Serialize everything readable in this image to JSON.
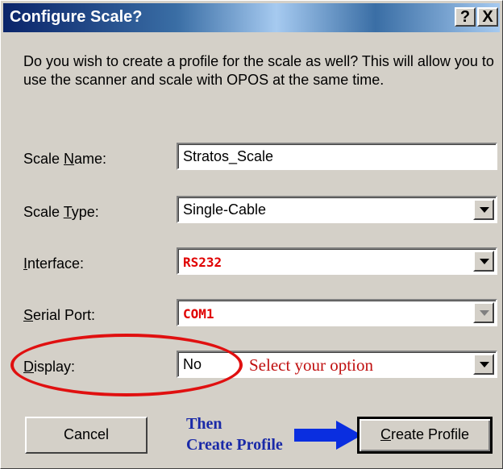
{
  "window": {
    "title": "Configure Scale?",
    "help_label": "?",
    "close_label": "X"
  },
  "description": "Do you wish to create a profile for the scale as well?  This will allow you to use the scanner and scale with OPOS at the same time.",
  "fields": {
    "scale_name": {
      "label_pre": "Scale ",
      "label_u": "N",
      "label_post": "ame:",
      "value": "Stratos_Scale"
    },
    "scale_type": {
      "label_pre": "Scale ",
      "label_u": "T",
      "label_post": "ype:",
      "value": "Single-Cable"
    },
    "interface": {
      "label_pre": "",
      "label_u": "I",
      "label_post": "nterface:",
      "value": "RS232"
    },
    "serial_port": {
      "label_pre": "",
      "label_u": "S",
      "label_post": "erial Port:",
      "value": "COM1"
    },
    "display": {
      "label_pre": "",
      "label_u": "D",
      "label_post": "isplay:",
      "value": "No"
    }
  },
  "buttons": {
    "cancel": "Cancel",
    "create_u": "C",
    "create_rest": "reate Profile"
  },
  "annotations": {
    "select_option": "Select your option",
    "then_line1": "Then",
    "then_line2": "Create Profile",
    "oval_color": "#e01010",
    "arrow_color": "#0a2ee0"
  }
}
